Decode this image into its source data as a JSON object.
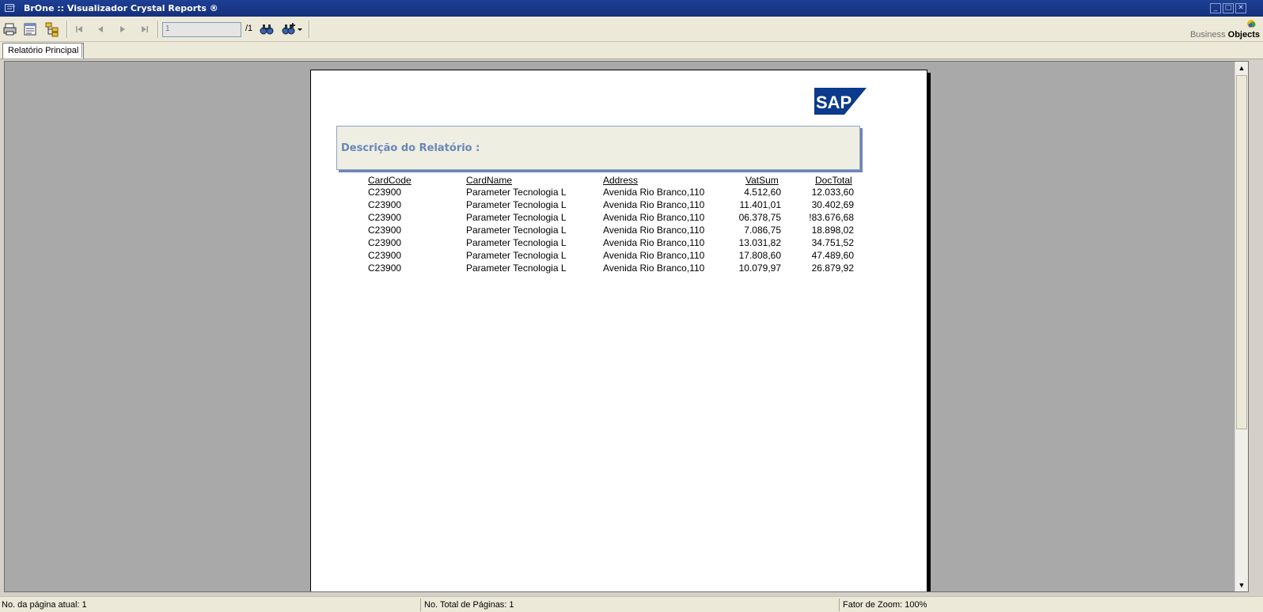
{
  "window": {
    "title": "BrOne :: Visualizador Crystal Reports ®"
  },
  "toolbar": {
    "page_value": "1",
    "page_total": "/1",
    "brand_a": "Business",
    "brand_b": "Objects"
  },
  "tabs": [
    {
      "label": "Relatório Principal"
    }
  ],
  "report": {
    "logo": "SAP",
    "description_label": "Descrição do Relatório  :",
    "columns": [
      "CardCode",
      "CardName",
      "Address",
      "VatSum",
      "DocTotal"
    ],
    "rows": [
      {
        "card_code": "C23900",
        "card_name": "Parameter Tecnologia L",
        "address": "Avenida Rio Branco,110",
        "vat_sum": "4.512,60",
        "doc_total": "12.033,60"
      },
      {
        "card_code": "C23900",
        "card_name": "Parameter Tecnologia L",
        "address": "Avenida Rio Branco,110",
        "vat_sum": "11.401,01",
        "doc_total": "30.402,69"
      },
      {
        "card_code": "C23900",
        "card_name": "Parameter Tecnologia L",
        "address": "Avenida Rio Branco,110",
        "vat_sum": "06.378,75",
        "doc_total": "!83.676,68"
      },
      {
        "card_code": "C23900",
        "card_name": "Parameter Tecnologia L",
        "address": "Avenida Rio Branco,110",
        "vat_sum": "7.086,75",
        "doc_total": "18.898,02"
      },
      {
        "card_code": "C23900",
        "card_name": "Parameter Tecnologia L",
        "address": "Avenida Rio Branco,110",
        "vat_sum": "13.031,82",
        "doc_total": "34.751,52"
      },
      {
        "card_code": "C23900",
        "card_name": "Parameter Tecnologia L",
        "address": "Avenida Rio Branco,110",
        "vat_sum": "17.808,60",
        "doc_total": "47.489,60"
      },
      {
        "card_code": "C23900",
        "card_name": "Parameter Tecnologia L",
        "address": "Avenida Rio Branco,110",
        "vat_sum": "10.079,97",
        "doc_total": "26.879,92"
      }
    ]
  },
  "status": {
    "current_page": "No. da página atual: 1",
    "total_pages": "No. Total de Páginas: 1",
    "zoom": "Fator de Zoom: 100%"
  },
  "colors": {
    "titlebar": "#1c3a8c",
    "viewer_bg": "#a9a9a9",
    "desc_text": "#6a86b8",
    "desc_bg": "#eeeee3",
    "sap_blue": "#0c3a8c"
  }
}
